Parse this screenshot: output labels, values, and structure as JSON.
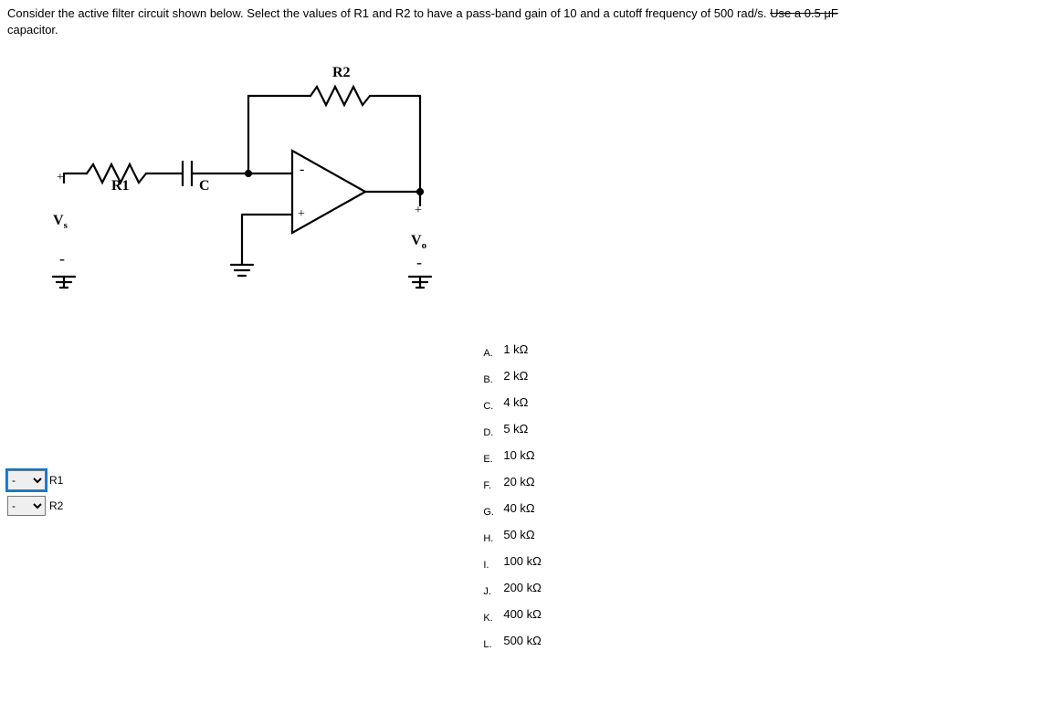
{
  "question": {
    "text_part1": "Consider the active filter circuit shown below. Select the values of R1 and R2 to have a pass-band gain of 10 and a cutoff frequency of 500 rad/s. ",
    "text_strike": "Use a 0.5 μF",
    "text_part2": "capacitor."
  },
  "circuit_labels": {
    "R1": "R1",
    "R2": "R2",
    "C": "C",
    "Vs_plus": "+",
    "Vs": "Vs",
    "Vs_minus": "-",
    "Vo_plus": "+",
    "Vo": "Vo",
    "Vo_minus": "-",
    "opamp_minus": "-",
    "opamp_plus": "+"
  },
  "dropdowns": [
    {
      "label": "R1",
      "value": "-",
      "selected": true
    },
    {
      "label": "R2",
      "value": "-",
      "selected": false
    }
  ],
  "options": [
    {
      "letter": "A.",
      "value": "1 kΩ"
    },
    {
      "letter": "B.",
      "value": "2 kΩ"
    },
    {
      "letter": "C.",
      "value": "4 kΩ"
    },
    {
      "letter": "D.",
      "value": "5 kΩ"
    },
    {
      "letter": "E.",
      "value": "10 kΩ"
    },
    {
      "letter": "F.",
      "value": "20 kΩ"
    },
    {
      "letter": "G.",
      "value": "40 kΩ"
    },
    {
      "letter": "H.",
      "value": "50 kΩ"
    },
    {
      "letter": "I.",
      "value": "100 kΩ"
    },
    {
      "letter": "J.",
      "value": "200 kΩ"
    },
    {
      "letter": "K.",
      "value": "400 kΩ"
    },
    {
      "letter": "L.",
      "value": "500 kΩ"
    }
  ]
}
